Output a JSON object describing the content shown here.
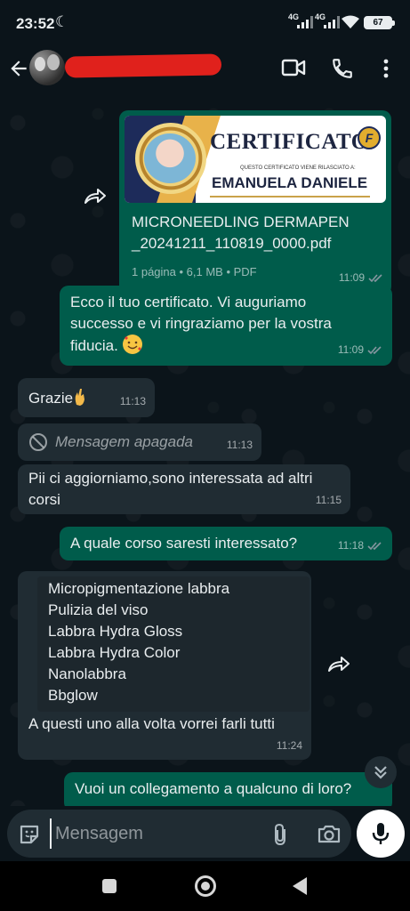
{
  "status": {
    "time": "23:52",
    "network1": "4G",
    "network2": "4G",
    "battery": "67"
  },
  "header": {
    "contact_name": ""
  },
  "messages": {
    "pdf": {
      "preview_title": "CERTIFICATO",
      "preview_subtitle": "QUESTO CERTIFICATO VIENE RILASCIATO A:",
      "preview_name": "EMANUELA DANIELE",
      "preview_logo": "F",
      "filename": "MICRONEEDLING DERMAPEN _20241211_110819_0000.pdf",
      "info": "1 página • 6,1 MB • PDF",
      "time": "11:09"
    },
    "m1": {
      "text": "Ecco il tuo certificato. Vi auguriamo successo e vi ringraziamo per la vostra fiducia. ",
      "time": "11:09"
    },
    "m2": {
      "text": "Grazie",
      "time": "11:13"
    },
    "m3": {
      "text": "Mensagem apagada",
      "time": "11:13"
    },
    "m4": {
      "text": "Pii ci aggiorniamo,sono interessata ad altri corsi",
      "time": "11:15"
    },
    "m5": {
      "text": "A quale corso saresti interessato?",
      "time": "11:18"
    },
    "m6": {
      "list": [
        "Micropigmentazione labbra",
        "Pulizia del viso",
        "Labbra Hydra Gloss",
        "Labbra Hydra Color",
        "Nanolabbra",
        "Bbglow"
      ],
      "text": "A questi uno alla volta vorrei farli tutti",
      "time": "11:24"
    },
    "m7": {
      "text": "Vuoi un collegamento a qualcuno di loro?"
    }
  },
  "input": {
    "placeholder": "Mensagem"
  },
  "colors": {
    "outgoing": "#005c4b",
    "incoming": "#202c33",
    "background": "#0b141a",
    "ticks": "#8696a0",
    "redaction": "#e0211c"
  }
}
